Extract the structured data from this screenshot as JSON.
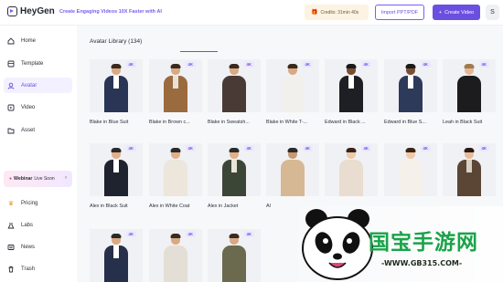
{
  "topbar": {
    "logo_text": "HeyGen",
    "tagline": "Create Engaging Videos 10X Faster with AI",
    "credits_label": "Credits: 31min 40s",
    "import_label": "Import PPT/PDF",
    "create_label": "Create Video",
    "user_initial": "S"
  },
  "sidebar": {
    "items": [
      {
        "label": "Home",
        "icon": "home-icon"
      },
      {
        "label": "Template",
        "icon": "template-icon"
      },
      {
        "label": "Avatar",
        "icon": "avatar-icon",
        "active": true
      },
      {
        "label": "Video",
        "icon": "video-icon"
      },
      {
        "label": "Asset",
        "icon": "asset-icon"
      },
      {
        "label": "Pricing",
        "icon": "pricing-icon"
      },
      {
        "label": "Labs",
        "icon": "labs-icon"
      },
      {
        "label": "News",
        "icon": "news-icon"
      },
      {
        "label": "Trash",
        "icon": "trash-icon"
      }
    ],
    "webinar_label": "Webinar",
    "webinar_status": "Live Soon"
  },
  "main": {
    "library_title": "Avatar Library (134)",
    "badge_label": "4K",
    "avatars": [
      {
        "name": "Blake in Blue Suit"
      },
      {
        "name": "Blake in Brown c..."
      },
      {
        "name": "Blake in Sweatsh..."
      },
      {
        "name": "Blake in White T-..."
      },
      {
        "name": "Edward in Black ..."
      },
      {
        "name": "Edward in Blue S..."
      },
      {
        "name": "Leah in Black Suit"
      },
      {
        "name": "Alex in Black Suit"
      },
      {
        "name": "Alex in White Coat"
      },
      {
        "name": "Alex in Jacket"
      },
      {
        "name": "Al"
      },
      {
        "name": ""
      },
      {
        "name": ""
      },
      {
        "name": ""
      },
      {
        "name": ""
      },
      {
        "name": ""
      },
      {
        "name": ""
      }
    ]
  },
  "watermark": {
    "text": "国宝手游网",
    "url": "-WWW.GB315.COM-"
  },
  "colors": {
    "accent": "#6b4fe0",
    "active_bg": "#f3f0ff",
    "badge_bg": "#ece8ff"
  }
}
